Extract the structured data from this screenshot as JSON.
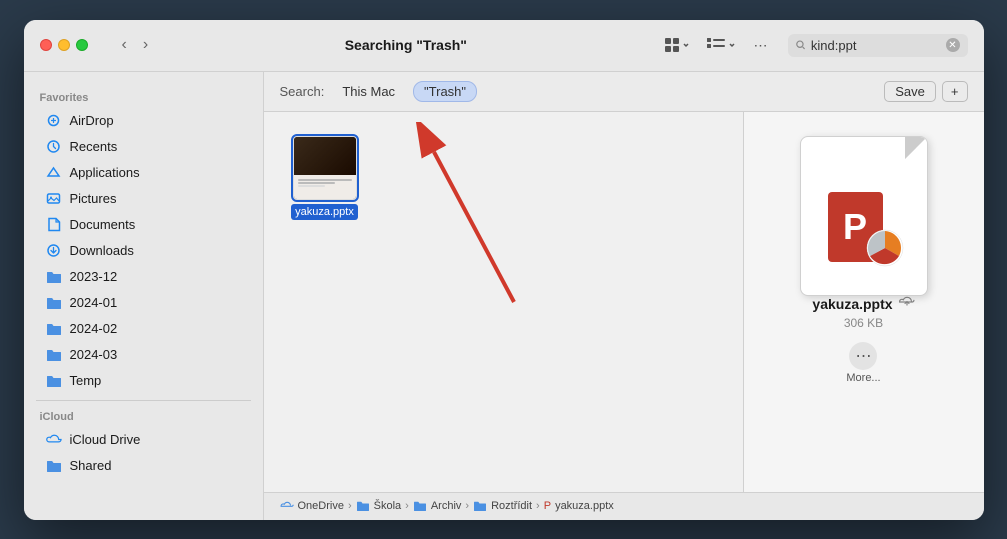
{
  "window": {
    "title": "Searching \"Trash\""
  },
  "titlebar": {
    "back_label": "‹",
    "forward_label": "›",
    "search_placeholder": "kind:ppt",
    "search_value": "kind:ppt"
  },
  "sidebar": {
    "favorites_label": "Favorites",
    "icloud_label": "iCloud",
    "items_favorites": [
      {
        "id": "airdrop",
        "label": "AirDrop",
        "icon": "📡"
      },
      {
        "id": "recents",
        "label": "Recents",
        "icon": "🕐"
      },
      {
        "id": "applications",
        "label": "Applications",
        "icon": "📦"
      },
      {
        "id": "pictures",
        "label": "Pictures",
        "icon": "🖼"
      },
      {
        "id": "documents",
        "label": "Documents",
        "icon": "📄"
      },
      {
        "id": "downloads",
        "label": "Downloads",
        "icon": "⬇"
      },
      {
        "id": "2023-12",
        "label": "2023-12",
        "icon": "📁"
      },
      {
        "id": "2024-01",
        "label": "2024-01",
        "icon": "📁"
      },
      {
        "id": "2024-02",
        "label": "2024-02",
        "icon": "📁"
      },
      {
        "id": "2024-03",
        "label": "2024-03",
        "icon": "📁"
      },
      {
        "id": "temp",
        "label": "Temp",
        "icon": "📁"
      }
    ],
    "items_icloud": [
      {
        "id": "icloud-drive",
        "label": "iCloud Drive",
        "icon": "☁"
      },
      {
        "id": "shared",
        "label": "Shared",
        "icon": "📁"
      }
    ]
  },
  "search": {
    "label": "Search:",
    "scope_thismac": "This Mac",
    "scope_trash": "\"Trash\"",
    "save_label": "Save",
    "add_label": "+"
  },
  "file": {
    "name": "yakuza.pptx",
    "name_selected": "yakuza.pptx",
    "size": "306 KB",
    "cloud_icon": "⬇",
    "more_label": "More..."
  },
  "breadcrumb": {
    "items": [
      {
        "id": "onedrive",
        "label": "OneDrive",
        "icon": "☁"
      },
      {
        "id": "skola",
        "label": "Škola",
        "icon": "📁"
      },
      {
        "id": "archiv",
        "label": "Archiv",
        "icon": "📁"
      },
      {
        "id": "roztridit",
        "label": "Roztřídit",
        "icon": "📁"
      },
      {
        "id": "file",
        "label": "yakuza.pptx",
        "icon": "📊"
      }
    ],
    "separator": "›"
  }
}
